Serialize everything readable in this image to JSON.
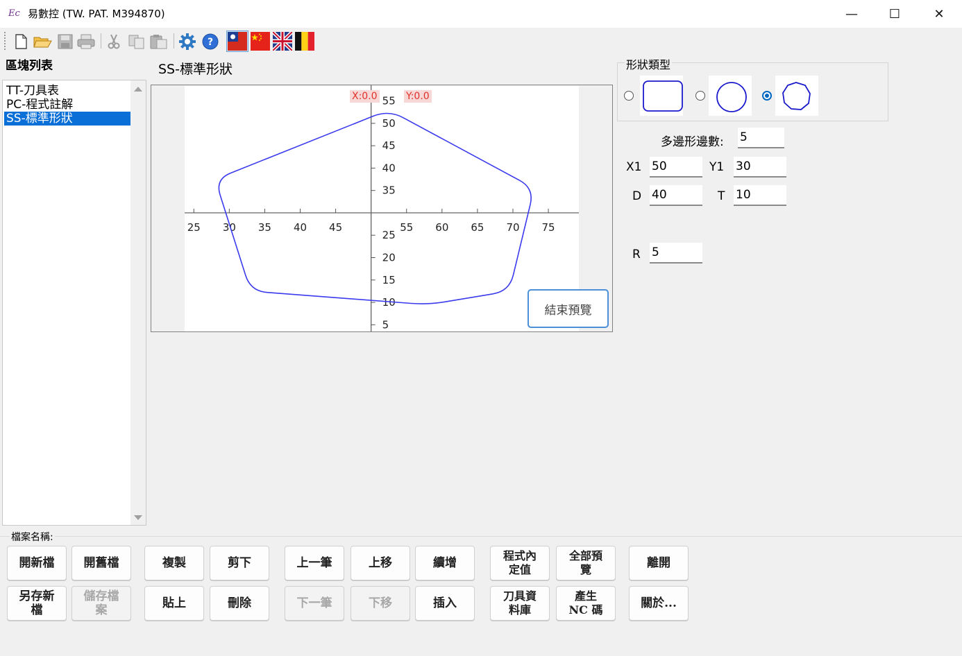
{
  "window": {
    "title": "易數控 (TW. PAT. M394870)",
    "app_icon_text": "Ec",
    "minimize": "—",
    "maximize": "☐",
    "close": "✕"
  },
  "toolbar": {
    "icons": [
      "new-file-icon",
      "open-folder-icon",
      "save-icon",
      "print-icon",
      "cut-icon",
      "copy-icon",
      "paste-icon",
      "settings-gear-icon",
      "help-icon"
    ],
    "flags": [
      "flag-taiwan-icon",
      "flag-china-icon",
      "flag-uk-icon",
      "flag-belgium-icon"
    ]
  },
  "blocklist": {
    "label": "區塊列表",
    "items": [
      "TT-刀具表",
      "PC-程式註解",
      "SS-標準形狀"
    ],
    "selected_index": 2
  },
  "preview": {
    "title": "SS-標準形狀",
    "readout_x": "X:0.0",
    "readout_y": "Y:0.0",
    "end_preview_label": "結束預覽"
  },
  "chart_data": {
    "type": "line",
    "xlim": [
      19,
      84
    ],
    "ylim": [
      3.5,
      58.5
    ],
    "x_axis_at_y": 30,
    "y_axis_at_x": 50,
    "x_ticks": [
      25,
      30,
      35,
      40,
      45,
      55,
      60,
      65,
      70,
      75
    ],
    "y_ticks": [
      5,
      10,
      15,
      20,
      25,
      35,
      40,
      45,
      50,
      55
    ],
    "grid": false,
    "series": [
      {
        "color": "#3a3aee",
        "points": [
          [
            52.5,
            53
          ],
          [
            73,
            35.5
          ],
          [
            69.5,
            12.5
          ],
          [
            58,
            9.5
          ],
          [
            33,
            12.5
          ],
          [
            28,
            37.5
          ],
          [
            52.5,
            53
          ]
        ]
      }
    ]
  },
  "shape_type": {
    "label": "形狀類型",
    "options": [
      "rounded-rectangle",
      "circle",
      "polygon"
    ],
    "selected_index": 2
  },
  "params": {
    "sides_label": "多邊形邊數:",
    "sides": "5",
    "x1_label": "X1",
    "x1": "50",
    "y1_label": "Y1",
    "y1": "30",
    "d_label": "D",
    "d": "40",
    "t_label": "T",
    "t": "10",
    "r_label": "R",
    "r": "5"
  },
  "file": {
    "name_label": "檔案名稱:"
  },
  "buttons": {
    "new_file": "開新檔",
    "open_file": "開舊檔",
    "copy": "複製",
    "cut": "剪下",
    "prev": "上一筆",
    "move_up": "上移",
    "continue_add": "續增",
    "program_defaults": "程式內\n定值",
    "preview_all": "全部預\n覽",
    "exit": "離開",
    "save_as": "另存新\n檔",
    "save": "儲存檔\n案",
    "paste": "貼上",
    "delete": "刪除",
    "next": "下一筆",
    "move_down": "下移",
    "insert": "插入",
    "tool_db": "刀具資\n料庫",
    "generate_nc": "產生\nNC 碼",
    "about": "關於..."
  }
}
